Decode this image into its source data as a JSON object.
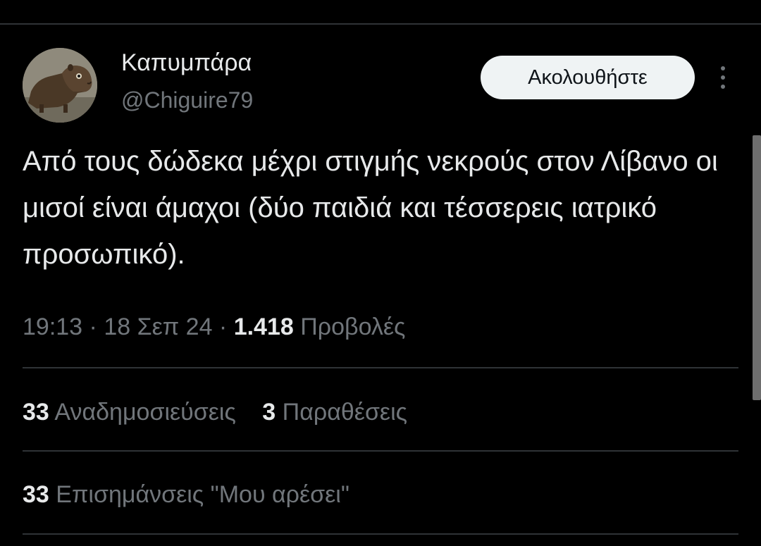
{
  "user": {
    "display_name": "Καπυμπάρα",
    "handle": "@Chiguire79"
  },
  "actions": {
    "follow_label": "Ακολουθήστε"
  },
  "tweet": {
    "text": "Από τους δώδεκα μέχρι στιγμής νεκρούς στον Λίβανο οι μισοί είναι άμαχοι (δύο παιδιά και τέσσερεις ιατρικό προσωπικό).",
    "time": "19:13",
    "date": "18 Σεπ 24",
    "separator": " · ",
    "views_count": "1.418",
    "views_label": "Προβολές"
  },
  "stats": {
    "reposts_count": "33",
    "reposts_label": "Αναδημοσιεύσεις",
    "quotes_count": "3",
    "quotes_label": "Παραθέσεις",
    "likes_count": "33",
    "likes_label": "Επισημάνσεις \"Μου αρέσει\""
  },
  "icons": {
    "more": "more-vertical-icon",
    "avatar": "capybara-avatar"
  },
  "colors": {
    "background": "#000000",
    "text_primary": "#e7e9ea",
    "text_secondary": "#71767b",
    "divider": "#2f3336",
    "button_bg": "#eff3f4",
    "button_text": "#0f1419"
  }
}
